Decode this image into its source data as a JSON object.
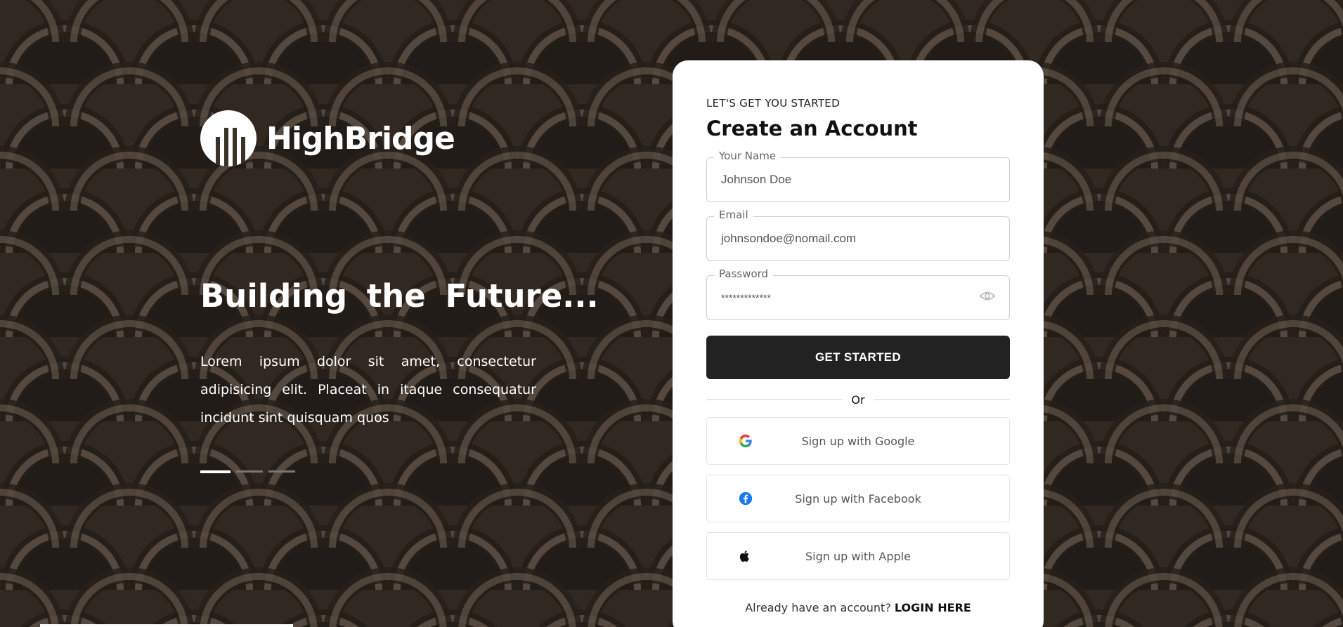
{
  "brand": {
    "name": "HighBridge"
  },
  "hero": {
    "title": "Building the Future...",
    "text": "Lorem ipsum dolor sit amet, consectetur adipisicing elit. Placeat in itaque consequatur incidunt sint quisquam quos",
    "slides": 3,
    "active_slide": 1
  },
  "form": {
    "eyebrow": "LET'S GET YOU STARTED",
    "title": "Create an Account",
    "name": {
      "label": "Your Name",
      "value": "Johnson Doe"
    },
    "email": {
      "label": "Email",
      "value": "johnsondoe@nomail.com"
    },
    "password": {
      "label": "Password",
      "value": "*************",
      "toggle_icon": "eye-icon"
    },
    "submit_label": "GET STARTED",
    "divider_label": "Or",
    "social": [
      {
        "label": "Sign up with Google",
        "icon": "google-icon"
      },
      {
        "label": "Sign up with Facebook",
        "icon": "facebook-icon"
      },
      {
        "label": "Sign up with Apple",
        "icon": "apple-icon"
      }
    ],
    "login_prompt": "Already have an account?",
    "login_link": "LOGIN HERE"
  },
  "colors": {
    "primary_button": "#222222",
    "facebook": "#1877F2"
  }
}
